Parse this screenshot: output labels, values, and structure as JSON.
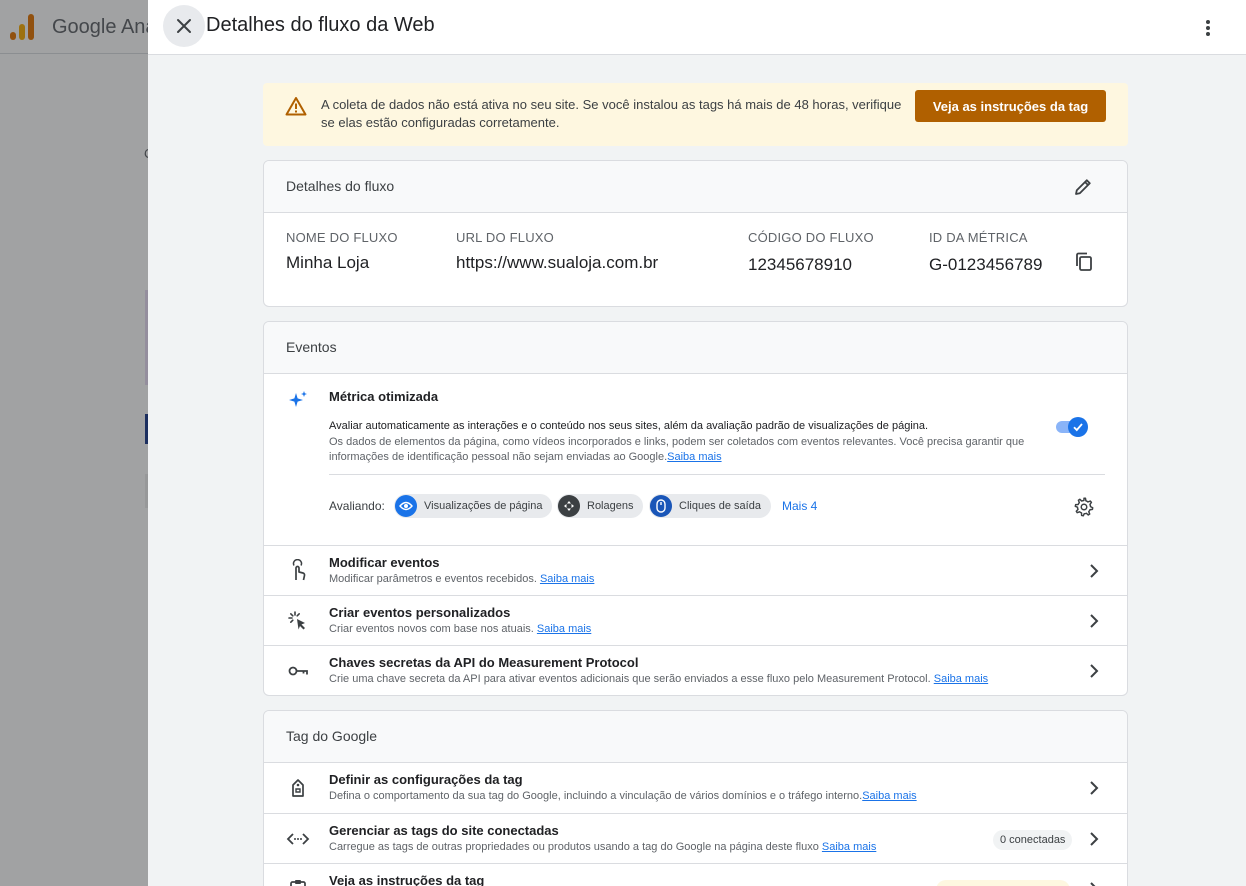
{
  "background": {
    "app_title": "Google Ana",
    "letter": "C"
  },
  "panel": {
    "title": "Detalhes do fluxo da Web"
  },
  "alert": {
    "text": "A coleta de dados não está ativa no seu site. Se você instalou as tags há mais de 48 horas, verifique se elas estão configuradas corretamente.",
    "button": "Veja as instruções da tag"
  },
  "details": {
    "title": "Detalhes do fluxo",
    "fields": [
      {
        "label": "NOME DO FLUXO",
        "value": "Minha Loja"
      },
      {
        "label": "URL DO FLUXO",
        "value": "https://www.sualoja.com.br"
      },
      {
        "label": "CÓDIGO DO FLUXO",
        "value": "12345678910"
      },
      {
        "label": "ID DA MÉTRICA",
        "value": "G-0123456789"
      }
    ]
  },
  "events": {
    "title": "Eventos",
    "enhanced": {
      "title": "Métrica otimizada",
      "desc1": "Avaliar automaticamente as interações e o conteúdo nos seus sites, além da avaliação padrão de visualizações de página.",
      "desc2": "Os dados de elementos da página, como vídeos incorporados e links, podem ser coletados com eventos relevantes. Você precisa garantir que informações de identificação pessoal não sejam enviadas ao Google.",
      "link": "Saiba mais",
      "measuring_label": "Avaliando:",
      "chips": [
        "Visualizações de página",
        "Rolagens",
        "Cliques de saída"
      ],
      "more": "Mais 4",
      "enabled": true
    },
    "rows": [
      {
        "title": "Modificar eventos",
        "sub": "Modificar parâmetros e eventos recebidos.",
        "link": "Saiba mais"
      },
      {
        "title": "Criar eventos personalizados",
        "sub": "Criar eventos novos com base nos atuais.",
        "link": "Saiba mais"
      },
      {
        "title": "Chaves secretas da API do Measurement Protocol",
        "sub": "Crie uma chave secreta da API para ativar eventos adicionais que serão enviados a esse fluxo pelo Measurement Protocol.",
        "link": "Saiba mais"
      }
    ]
  },
  "google_tag": {
    "title": "Tag do Google",
    "rows": [
      {
        "title": "Definir as configurações da tag",
        "sub": "Defina o comportamento da sua tag do Google, incluindo a vinculação de vários domínios e o tráfego interno.",
        "link": "Saiba mais"
      },
      {
        "title": "Gerenciar as tags do site conectadas",
        "sub": "Carregue as tags de outras propriedades ou produtos usando a tag do Google na página deste fluxo",
        "link": "Saiba mais",
        "badge": "0 conectadas"
      },
      {
        "title": "Veja as instruções da tag",
        "sub": "",
        "link": ""
      }
    ]
  },
  "colors": {
    "accent": "#1a73e8",
    "warning_button": "#b06000",
    "warning_bg": "#fef7e0"
  }
}
